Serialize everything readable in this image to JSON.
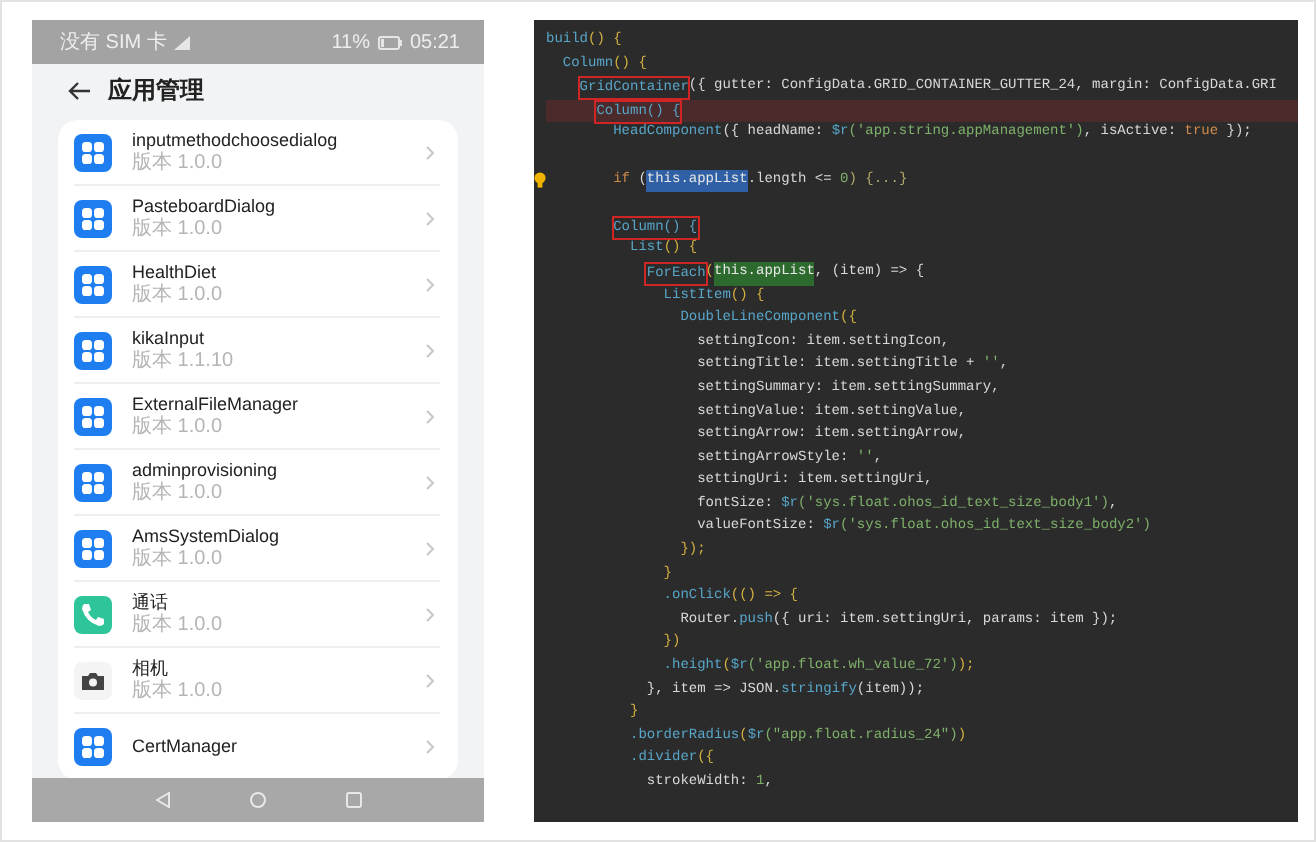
{
  "phone": {
    "status_bar": {
      "carrier": "没有 SIM 卡",
      "battery": "11%",
      "time": "05:21"
    },
    "header": {
      "title": "应用管理"
    },
    "apps": [
      {
        "name": "inputmethodchoosedialog",
        "version": "版本 1.0.0",
        "kind": "grid"
      },
      {
        "name": "PasteboardDialog",
        "version": "版本 1.0.0",
        "kind": "grid"
      },
      {
        "name": "HealthDiet",
        "version": "版本 1.0.0",
        "kind": "grid"
      },
      {
        "name": "kikaInput",
        "version": "版本 1.1.10",
        "kind": "grid"
      },
      {
        "name": "ExternalFileManager",
        "version": "版本 1.0.0",
        "kind": "grid"
      },
      {
        "name": "adminprovisioning",
        "version": "版本 1.0.0",
        "kind": "grid"
      },
      {
        "name": "AmsSystemDialog",
        "version": "版本 1.0.0",
        "kind": "grid"
      },
      {
        "name": "通话",
        "version": "版本 1.0.0",
        "kind": "phone"
      },
      {
        "name": "相机",
        "version": "版本 1.0.0",
        "kind": "camera"
      },
      {
        "name": "CertManager",
        "kind": "grid"
      }
    ]
  },
  "code": {
    "lines": [
      {
        "flagged": false,
        "hint": false,
        "parts": [
          {
            "text": "build",
            "kind": "fn"
          },
          {
            "text": "() {",
            "kind": "punct"
          }
        ],
        "children": [
          {
            "flagged": false,
            "hint": false,
            "parts": [
              {
                "text": "Column",
                "kind": "fn"
              },
              {
                "text": "() {",
                "kind": "punct"
              }
            ],
            "children": [
              {
                "flagged": false,
                "hint": false,
                "parts": [
                  {
                    "text": "GridContainer",
                    "kind": "boxed"
                  },
                  {
                    "text": "({ gutter: ConfigData.GRID_CONTAINER_GUTTER_24, margin: ConfigData.GRI",
                    "kind": "plain"
                  }
                ],
                "children": [
                  {
                    "flagged": true,
                    "hint": false,
                    "parts": [
                      {
                        "text": "Column() {",
                        "kind": "boxed"
                      }
                    ],
                    "children": [
                      {
                        "flagged": false,
                        "hint": false,
                        "parts": [
                          {
                            "text": "HeadComponent",
                            "kind": "fn"
                          },
                          {
                            "text": "({ headName: ",
                            "kind": "plain"
                          },
                          {
                            "text": "$r",
                            "kind": "fn"
                          },
                          {
                            "text": "('app.string.appManagement')",
                            "kind": "str"
                          },
                          {
                            "text": ", isActive: ",
                            "kind": "plain"
                          },
                          {
                            "text": "true",
                            "kind": "kw"
                          },
                          {
                            "text": " });",
                            "kind": "plain"
                          }
                        ]
                      },
                      {
                        "flagged": false,
                        "hint": false
                      },
                      {
                        "flagged": false,
                        "hint": true,
                        "parts": [
                          {
                            "text": "if",
                            "kind": "kw"
                          },
                          {
                            "text": " (",
                            "kind": "plain"
                          },
                          {
                            "text": "this.appList",
                            "kind": "sel"
                          },
                          {
                            "text": ".length <= ",
                            "kind": "plain"
                          },
                          {
                            "text": "0",
                            "kind": "num"
                          },
                          {
                            "text": ") {...}",
                            "kind": "fold"
                          }
                        ]
                      },
                      {
                        "flagged": false,
                        "hint": false
                      },
                      {
                        "flagged": false,
                        "hint": false,
                        "parts": [
                          {
                            "text": "Column() {",
                            "kind": "boxed"
                          }
                        ],
                        "children": [
                          {
                            "flagged": false,
                            "hint": false,
                            "parts": [
                              {
                                "text": "List",
                                "kind": "fn"
                              },
                              {
                                "text": "() {",
                                "kind": "punct"
                              }
                            ],
                            "children": [
                              {
                                "flagged": false,
                                "hint": false,
                                "parts": [
                                  {
                                    "text": "ForEach",
                                    "kind": "boxed"
                                  },
                                  {
                                    "text": "(",
                                    "kind": "punct"
                                  },
                                  {
                                    "text": "this.appList",
                                    "kind": "match"
                                  },
                                  {
                                    "text": ", (item) => {",
                                    "kind": "plain"
                                  }
                                ],
                                "children": [
                                  {
                                    "flagged": false,
                                    "hint": false,
                                    "parts": [
                                      {
                                        "text": "ListItem",
                                        "kind": "fn"
                                      },
                                      {
                                        "text": "() {",
                                        "kind": "punct"
                                      }
                                    ],
                                    "children": [
                                      {
                                        "flagged": false,
                                        "hint": false,
                                        "parts": [
                                          {
                                            "text": "DoubleLineComponent",
                                            "kind": "fn"
                                          },
                                          {
                                            "text": "({",
                                            "kind": "punct"
                                          }
                                        ],
                                        "children": [
                                          {
                                            "flagged": false,
                                            "hint": false,
                                            "parts": [
                                              {
                                                "text": "settingIcon: item.settingIcon,",
                                                "kind": "plain"
                                              }
                                            ]
                                          },
                                          {
                                            "flagged": false,
                                            "hint": false,
                                            "parts": [
                                              {
                                                "text": "settingTitle: item.settingTitle + ",
                                                "kind": "plain"
                                              },
                                              {
                                                "text": "''",
                                                "kind": "str"
                                              },
                                              {
                                                "text": ",",
                                                "kind": "plain"
                                              }
                                            ]
                                          },
                                          {
                                            "flagged": false,
                                            "hint": false,
                                            "parts": [
                                              {
                                                "text": "settingSummary: item.settingSummary,",
                                                "kind": "plain"
                                              }
                                            ]
                                          },
                                          {
                                            "flagged": false,
                                            "hint": false,
                                            "parts": [
                                              {
                                                "text": "settingValue: item.settingValue,",
                                                "kind": "plain"
                                              }
                                            ]
                                          },
                                          {
                                            "flagged": false,
                                            "hint": false,
                                            "parts": [
                                              {
                                                "text": "settingArrow: item.settingArrow,",
                                                "kind": "plain"
                                              }
                                            ]
                                          },
                                          {
                                            "flagged": false,
                                            "hint": false,
                                            "parts": [
                                              {
                                                "text": "settingArrowStyle: ",
                                                "kind": "plain"
                                              },
                                              {
                                                "text": "''",
                                                "kind": "str"
                                              },
                                              {
                                                "text": ",",
                                                "kind": "plain"
                                              }
                                            ]
                                          },
                                          {
                                            "flagged": false,
                                            "hint": false,
                                            "parts": [
                                              {
                                                "text": "settingUri: item.settingUri,",
                                                "kind": "plain"
                                              }
                                            ]
                                          },
                                          {
                                            "flagged": false,
                                            "hint": false,
                                            "parts": [
                                              {
                                                "text": "fontSize: ",
                                                "kind": "plain"
                                              },
                                              {
                                                "text": "$r",
                                                "kind": "fn"
                                              },
                                              {
                                                "text": "('sys.float.ohos_id_text_size_body1')",
                                                "kind": "str"
                                              },
                                              {
                                                "text": ",",
                                                "kind": "plain"
                                              }
                                            ]
                                          },
                                          {
                                            "flagged": false,
                                            "hint": false,
                                            "parts": [
                                              {
                                                "text": "valueFontSize: ",
                                                "kind": "plain"
                                              },
                                              {
                                                "text": "$r",
                                                "kind": "fn"
                                              },
                                              {
                                                "text": "('sys.float.ohos_id_text_size_body2')",
                                                "kind": "str"
                                              }
                                            ]
                                          }
                                        ]
                                      },
                                      {
                                        "flagged": false,
                                        "hint": false,
                                        "parts": [
                                          {
                                            "text": "});",
                                            "kind": "punct"
                                          }
                                        ]
                                      }
                                    ]
                                  },
                                  {
                                    "flagged": false,
                                    "hint": false,
                                    "parts": [
                                      {
                                        "text": "}",
                                        "kind": "punct"
                                      }
                                    ]
                                  },
                                  {
                                    "flagged": false,
                                    "hint": false,
                                    "parts": [
                                      {
                                        "text": ".onClick",
                                        "kind": "fn"
                                      },
                                      {
                                        "text": "(() => {",
                                        "kind": "punct"
                                      }
                                    ],
                                    "children": [
                                      {
                                        "flagged": false,
                                        "hint": false,
                                        "parts": [
                                          {
                                            "text": "Router.",
                                            "kind": "plain"
                                          },
                                          {
                                            "text": "push",
                                            "kind": "fn"
                                          },
                                          {
                                            "text": "({ uri: item.settingUri, params: item });",
                                            "kind": "plain"
                                          }
                                        ]
                                      }
                                    ]
                                  },
                                  {
                                    "flagged": false,
                                    "hint": false,
                                    "parts": [
                                      {
                                        "text": "})",
                                        "kind": "punct"
                                      }
                                    ]
                                  },
                                  {
                                    "flagged": false,
                                    "hint": false,
                                    "parts": [
                                      {
                                        "text": ".height",
                                        "kind": "fn"
                                      },
                                      {
                                        "text": "(",
                                        "kind": "punct"
                                      },
                                      {
                                        "text": "$r",
                                        "kind": "fn"
                                      },
                                      {
                                        "text": "('app.float.wh_value_72')",
                                        "kind": "str"
                                      },
                                      {
                                        "text": ");",
                                        "kind": "punct"
                                      }
                                    ]
                                  }
                                ]
                              },
                              {
                                "flagged": false,
                                "hint": false,
                                "parts": [
                                  {
                                    "text": "}, item => JSON.",
                                    "kind": "plain"
                                  },
                                  {
                                    "text": "stringify",
                                    "kind": "fn"
                                  },
                                  {
                                    "text": "(item));",
                                    "kind": "plain"
                                  }
                                ]
                              }
                            ]
                          },
                          {
                            "flagged": false,
                            "hint": false,
                            "parts": [
                              {
                                "text": "}",
                                "kind": "punct"
                              }
                            ]
                          },
                          {
                            "flagged": false,
                            "hint": false,
                            "parts": [
                              {
                                "text": ".borderRadius",
                                "kind": "fn"
                              },
                              {
                                "text": "(",
                                "kind": "punct"
                              },
                              {
                                "text": "$r",
                                "kind": "fn"
                              },
                              {
                                "text": "(\"app.float.radius_24\")",
                                "kind": "str"
                              },
                              {
                                "text": ")",
                                "kind": "punct"
                              }
                            ]
                          },
                          {
                            "flagged": false,
                            "hint": false,
                            "parts": [
                              {
                                "text": ".divider",
                                "kind": "fn"
                              },
                              {
                                "text": "({",
                                "kind": "punct"
                              }
                            ],
                            "children": [
                              {
                                "flagged": false,
                                "hint": false,
                                "parts": [
                                  {
                                    "text": "strokeWidth: ",
                                    "kind": "plain"
                                  },
                                  {
                                    "text": "1",
                                    "kind": "num"
                                  },
                                  {
                                    "text": ",",
                                    "kind": "plain"
                                  }
                                ]
                              }
                            ]
                          }
                        ]
                      }
                    ]
                  }
                ]
              }
            ]
          }
        ]
      }
    ]
  }
}
